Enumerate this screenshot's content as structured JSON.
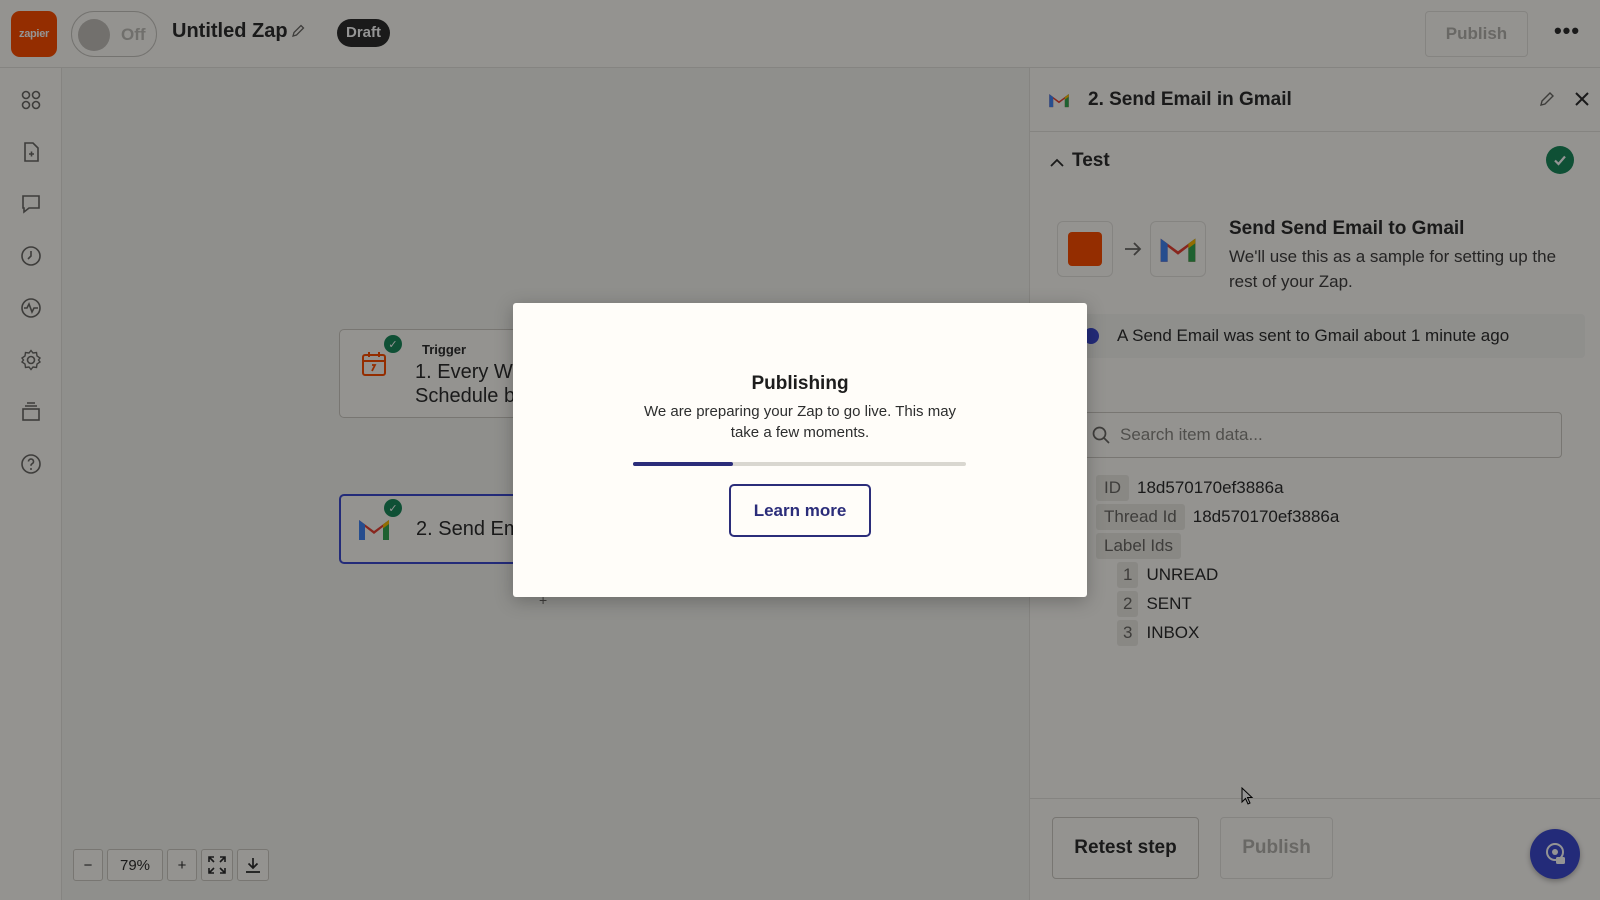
{
  "topbar": {
    "logo_text": "zapier",
    "toggle_label": "Off",
    "zap_title": "Untitled Zap",
    "status_badge": "Draft",
    "publish_label": "Publish",
    "more_label": "•••"
  },
  "left_rail": {
    "icons": [
      "apps-icon",
      "file-icon",
      "comment-icon",
      "history-icon",
      "activity-icon",
      "settings-icon",
      "layers-icon",
      "help-icon"
    ]
  },
  "canvas": {
    "trigger_node": {
      "label": "Trigger",
      "title_line1": "1. Every We",
      "title_line2": "Schedule b"
    },
    "action_node": {
      "title": "2. Send Em"
    },
    "plus_mark": "+",
    "zoom": {
      "minus": "−",
      "level": "79%",
      "plus": "+"
    }
  },
  "panel": {
    "title": "2. Send Email in Gmail",
    "test_label": "Test",
    "sample": {
      "title": "Send Send Email to Gmail",
      "description": "We'll use this as a sample for setting up the rest of your Zap."
    },
    "sent_message": "A Send Email was sent to Gmail about 1 minute ago",
    "search_placeholder": "Search item data...",
    "data_items": [
      {
        "key": "ID",
        "value": "18d570170ef3886a"
      },
      {
        "key": "Thread Id",
        "value": "18d570170ef3886a"
      },
      {
        "key": "Label Ids",
        "value": ""
      }
    ],
    "label_ids": [
      {
        "index": "1",
        "value": "UNREAD"
      },
      {
        "index": "2",
        "value": "SENT"
      },
      {
        "index": "3",
        "value": "INBOX"
      }
    ],
    "retest_label": "Retest step",
    "publish_label": "Publish"
  },
  "modal": {
    "title": "Publishing",
    "description": "We are preparing your Zap to go live. This may take a few moments.",
    "progress": 0.3,
    "learn_more_label": "Learn more"
  },
  "colors": {
    "brand": "#ff4f00",
    "accent": "#3d4ad0",
    "modal_accent": "#2b2d7a",
    "success": "#1a8a5c"
  }
}
